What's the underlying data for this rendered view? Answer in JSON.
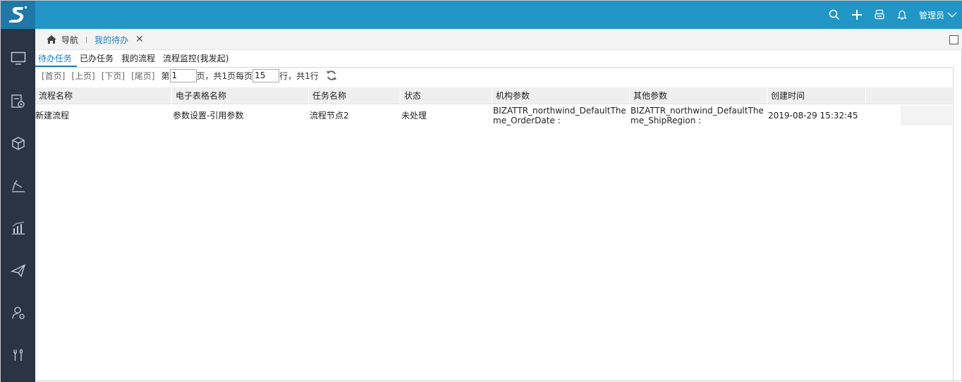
{
  "header": {
    "user_label": "管理员",
    "icons": [
      "search-icon",
      "plus-icon",
      "printer-icon",
      "bell-icon",
      "chevron-down-icon"
    ]
  },
  "sidebar": {
    "icons": [
      "monitor-icon",
      "settings-doc-icon",
      "cube-icon",
      "pen-icon",
      "bar-chart-icon",
      "paper-plane-icon",
      "user-settings-icon",
      "tools-icon"
    ]
  },
  "tabs": {
    "home_label": "导航",
    "active_label": "我的待办"
  },
  "subtabs": [
    "待办任务",
    "已办任务",
    "我的流程",
    "流程监控(我发起)"
  ],
  "pager": {
    "first": "[首页]",
    "prev": "[上页]",
    "next": "[下页]",
    "last": "[尾页]",
    "page_prefix": "第",
    "page_value": "1",
    "page_suffix": "页，共1页每页",
    "rows_value": "15",
    "rows_suffix": "行，共1行"
  },
  "table": {
    "columns": [
      "流程名称",
      "电子表格名称",
      "任务名称",
      "状态",
      "机构参数",
      "其他参数",
      "创建时间"
    ],
    "rows": [
      [
        "新建流程",
        "参数设置-引用参数",
        "流程节点2",
        "未处理",
        "BIZATTR_northwind_DefaultTheme_OrderDate :",
        "BIZATTR_northwind_DefaultTheme_ShipRegion :",
        "2019-08-29 15:32:45"
      ]
    ]
  },
  "colors": {
    "topbar": "#2196c6",
    "sidebar": "#293445",
    "accent": "#1f7fbf"
  }
}
